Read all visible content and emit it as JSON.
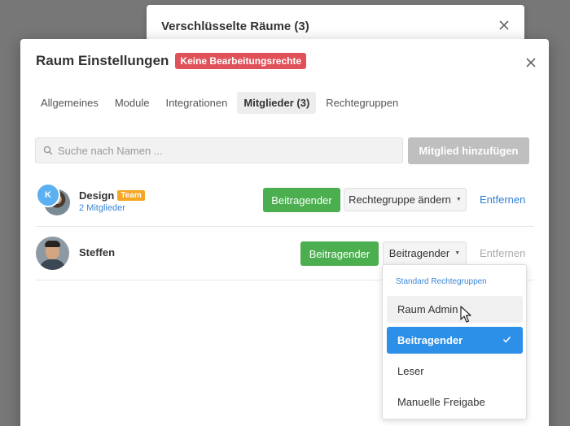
{
  "background_modal": {
    "title": "Verschlüsselte Räume (3)"
  },
  "modal": {
    "title": "Raum Einstellungen",
    "badge": "Keine Bearbeitungsrechte",
    "tabs": [
      {
        "label": "Allgemeines",
        "active": false
      },
      {
        "label": "Module",
        "active": false
      },
      {
        "label": "Integrationen",
        "active": false
      },
      {
        "label": "Mitglieder (3)",
        "active": true
      },
      {
        "label": "Rechtegruppen",
        "active": false
      }
    ],
    "search": {
      "placeholder": "Suche nach Namen ...",
      "value": ""
    },
    "add_button": "Mitglied hinzufügen"
  },
  "members": [
    {
      "name": "Design",
      "tag": "Team",
      "sub": "2 Mitglieder",
      "avatar_initial": "K",
      "role": "Beitragender",
      "dropdown": "Rechtegruppe ändern",
      "remove": "Entfernen"
    },
    {
      "name": "Steffen",
      "role": "Beitragender",
      "dropdown": "Beitragender",
      "remove": "Entfernen"
    }
  ],
  "role_dropdown": {
    "header": "Standard Rechtegruppen",
    "items": [
      {
        "label": "Raum Admin",
        "state": "hover"
      },
      {
        "label": "Beitragender",
        "state": "selected"
      },
      {
        "label": "Leser",
        "state": "normal"
      },
      {
        "label": "Manuelle Freigabe",
        "state": "normal"
      }
    ]
  },
  "icons": {
    "search": "search-icon",
    "close": "close-icon",
    "caret": "caret-down-icon",
    "check": "check-icon",
    "cursor": "mouse-pointer-icon"
  },
  "colors": {
    "danger_badge": "#e0525a",
    "team_badge": "#f5a623",
    "success": "#4bae4f",
    "link": "#2f7fcf",
    "selected": "#2c8fe8",
    "disabled_button": "#bfbfbf"
  }
}
